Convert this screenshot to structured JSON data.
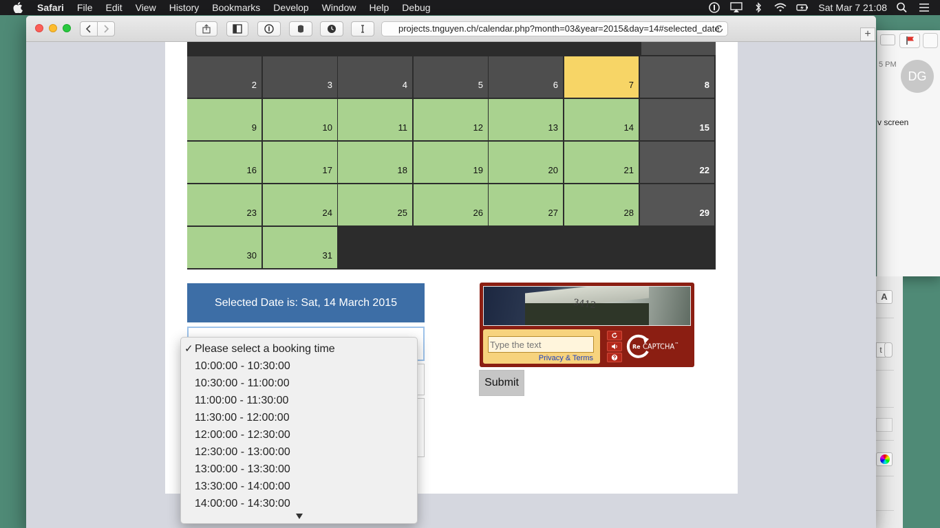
{
  "menubar": {
    "app": "Safari",
    "items": [
      "File",
      "Edit",
      "View",
      "History",
      "Bookmarks",
      "Develop",
      "Window",
      "Help",
      "Debug"
    ],
    "clock": "Sat Mar 7  21:08"
  },
  "browser": {
    "url": "projects.tnguyen.ch/calendar.php?month=03&year=2015&day=14#selected_date"
  },
  "background_window": {
    "time": "5 PM",
    "avatar_initials": "DG",
    "snippet": "v screen",
    "format_letter": "A",
    "stepper_value": "t"
  },
  "calendar": {
    "rows": [
      [
        {
          "day": "2",
          "state": "past"
        },
        {
          "day": "3",
          "state": "past"
        },
        {
          "day": "4",
          "state": "past"
        },
        {
          "day": "5",
          "state": "past"
        },
        {
          "day": "6",
          "state": "past"
        },
        {
          "day": "7",
          "state": "today"
        },
        {
          "day": "8",
          "state": "weekend"
        }
      ],
      [
        {
          "day": "9",
          "state": "avail"
        },
        {
          "day": "10",
          "state": "avail"
        },
        {
          "day": "11",
          "state": "avail"
        },
        {
          "day": "12",
          "state": "avail"
        },
        {
          "day": "13",
          "state": "avail"
        },
        {
          "day": "14",
          "state": "avail"
        },
        {
          "day": "15",
          "state": "weekend"
        }
      ],
      [
        {
          "day": "16",
          "state": "avail"
        },
        {
          "day": "17",
          "state": "avail"
        },
        {
          "day": "18",
          "state": "avail"
        },
        {
          "day": "19",
          "state": "avail"
        },
        {
          "day": "20",
          "state": "avail"
        },
        {
          "day": "21",
          "state": "avail"
        },
        {
          "day": "22",
          "state": "weekend"
        }
      ],
      [
        {
          "day": "23",
          "state": "avail"
        },
        {
          "day": "24",
          "state": "avail"
        },
        {
          "day": "25",
          "state": "avail"
        },
        {
          "day": "26",
          "state": "avail"
        },
        {
          "day": "27",
          "state": "avail"
        },
        {
          "day": "28",
          "state": "avail"
        },
        {
          "day": "29",
          "state": "weekend"
        }
      ],
      [
        {
          "day": "30",
          "state": "avail"
        },
        {
          "day": "31",
          "state": "avail"
        }
      ]
    ]
  },
  "booking": {
    "selected_date": "Selected Date is: Sat, 14 March 2015",
    "time_options": [
      "Please select a booking time",
      "10:00:00 - 10:30:00",
      "10:30:00 - 11:00:00",
      "11:00:00 - 11:30:00",
      "11:30:00 - 12:00:00",
      "12:00:00 - 12:30:00",
      "12:30:00 - 13:00:00",
      "13:00:00 - 13:30:00",
      "13:30:00 - 14:00:00",
      "14:00:00 - 14:30:00"
    ],
    "selected_index": 0,
    "submit_label": "Submit"
  },
  "captcha": {
    "image_text": "3412",
    "placeholder": "Type the text",
    "privacy_link": "Privacy & Terms",
    "brand": "CAPTCHA",
    "brand_prefix": "Re",
    "trademark": "™"
  },
  "colors": {
    "past": "#4e4e4e",
    "available": "#a9d28f",
    "today": "#f7d566",
    "weekend": "#555555",
    "banner": "#3d6ea6",
    "captcha_frame": "#8b1e12"
  }
}
